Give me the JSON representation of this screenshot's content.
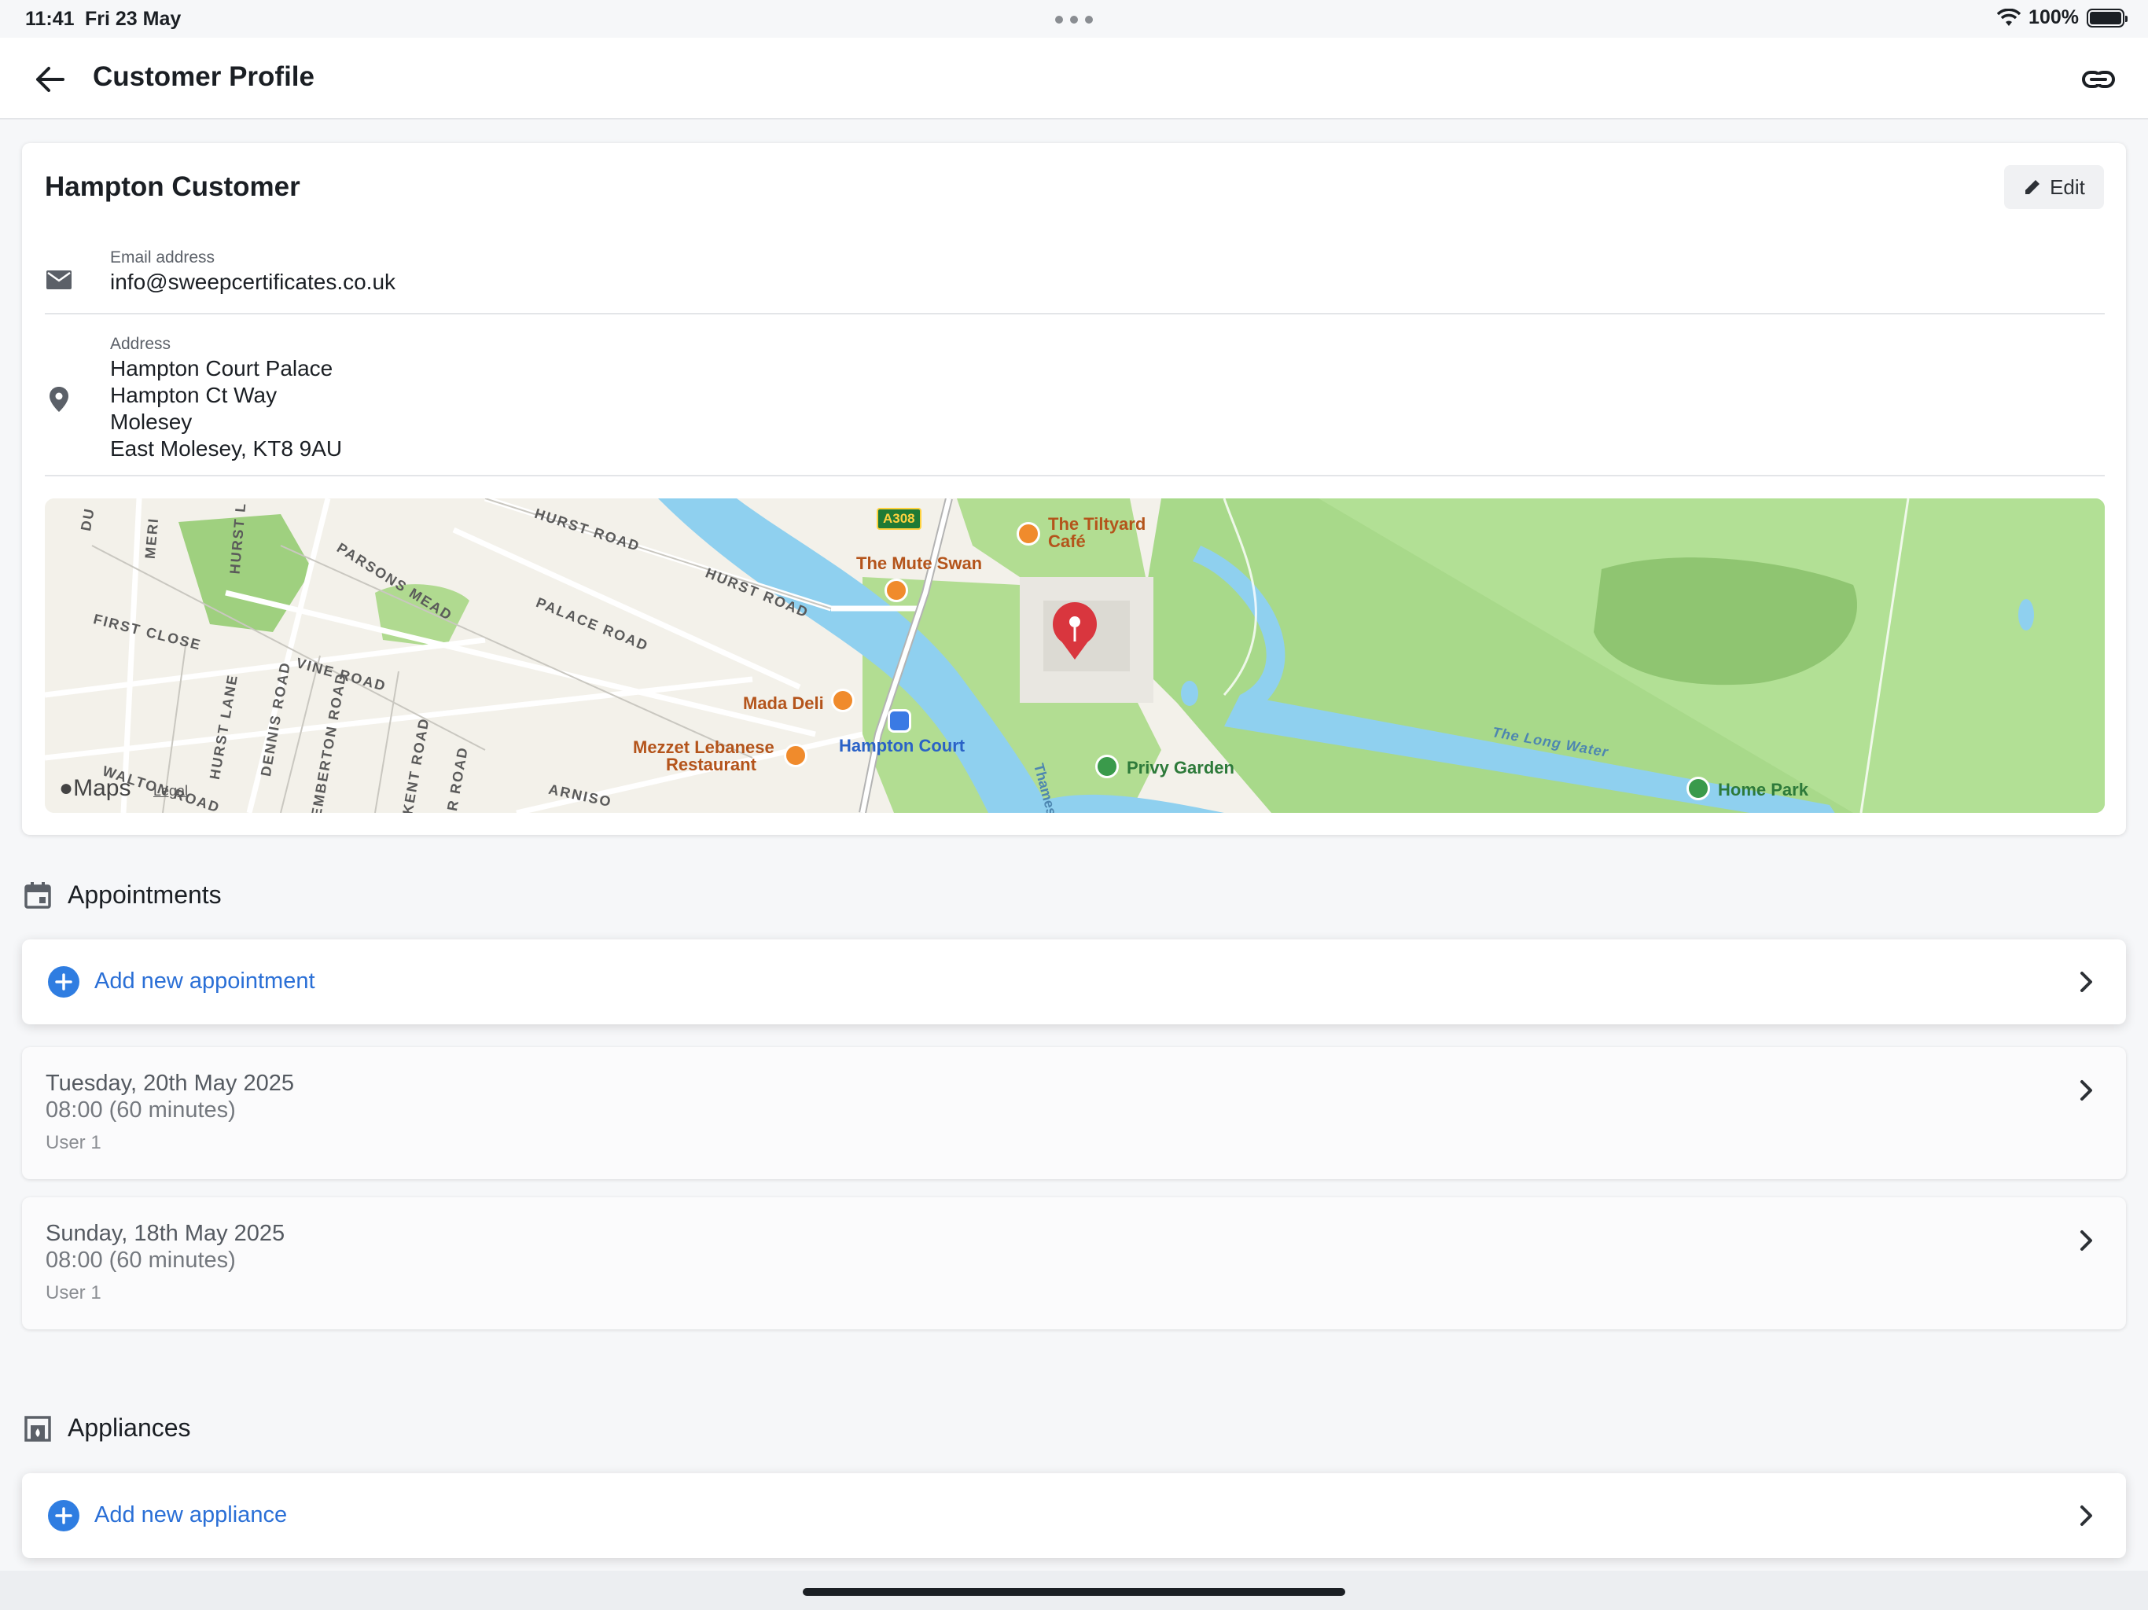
{
  "status_bar": {
    "time": "11:41",
    "date": "Fri 23 May",
    "battery": "100%"
  },
  "header": {
    "title": "Customer Profile"
  },
  "customer": {
    "name": "Hampton Customer",
    "edit_label": "Edit",
    "email_label": "Email address",
    "email": "info@sweepcertificates.co.uk",
    "address_label": "Address",
    "address_lines": [
      "Hampton Court Palace",
      "Hampton Ct Way",
      "Molesey",
      "East Molesey, KT8 9AU"
    ]
  },
  "map": {
    "labels": {
      "tiltyard": "The Tiltyard",
      "tiltyard2": "Café",
      "mute_swan": "The Mute Swan",
      "mada_deli": "Mada Deli",
      "mezzet1": "Mezzet Lebanese",
      "mezzet2": "Restaurant",
      "hampton_court": "Hampton Court",
      "privy_garden": "Privy Garden",
      "home_park": "Home Park",
      "long_water": "The Long Water",
      "thames": "Thames",
      "a_road": "A308",
      "hurst_road_1": "HURST ROAD",
      "hurst_road_2": "HURST ROAD",
      "palace_road": "PALACE ROAD",
      "vine_road": "VINE ROAD",
      "parsons_mead": "PARSONS MEAD",
      "first_close": "FIRST CLOSE",
      "hurst_lane": "HURST LANE",
      "dennis_road": "DENNIS ROAD",
      "pemberton_road": "PEMBERTON ROAD",
      "kent_road": "KENT ROAD",
      "walton_road": "WALTON ROAD",
      "arnison": "ARNISO",
      "meri": "MERI",
      "hurst_short": "HURST L",
      "du": "DU",
      "r_road": "R ROAD"
    },
    "attribution": "Maps",
    "legal": "Legal"
  },
  "appointments": {
    "title": "Appointments",
    "add_label": "Add new appointment",
    "items": [
      {
        "date": "Tuesday, 20th May 2025",
        "time": "08:00 (60 minutes)",
        "user": "User 1"
      },
      {
        "date": "Sunday, 18th May 2025",
        "time": "08:00 (60 minutes)",
        "user": "User 1"
      }
    ]
  },
  "appliances": {
    "title": "Appliances",
    "add_label": "Add new appliance"
  },
  "colors": {
    "accent": "#2f7de1",
    "pin": "#d9363e",
    "park": "#a9d98a",
    "water": "#8fd0ef"
  }
}
